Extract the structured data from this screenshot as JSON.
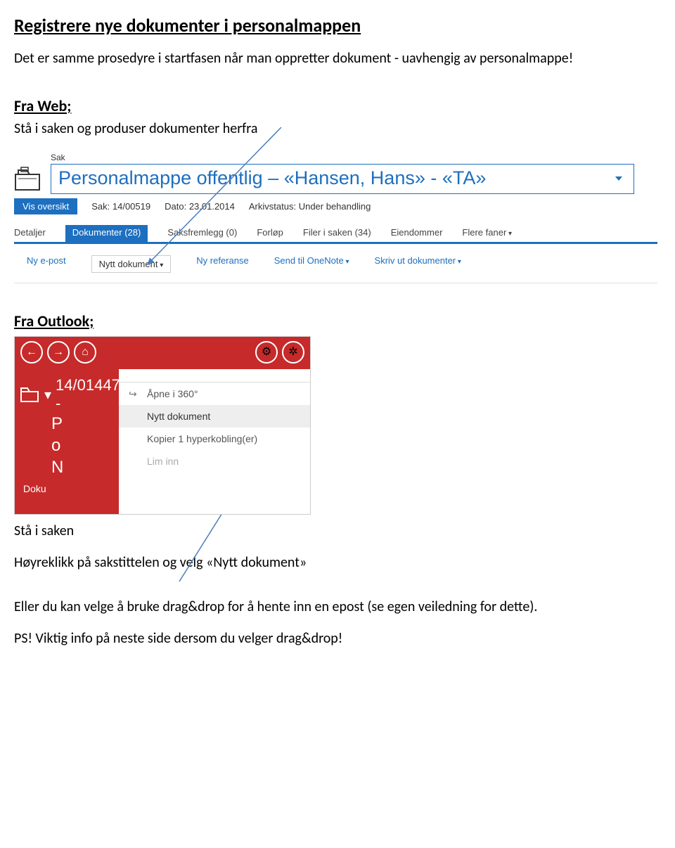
{
  "headings": {
    "h1": "Registrere nye dokumenter i personalmappen",
    "h2a": "Fra Web;",
    "h2b": "Fra Outlook;"
  },
  "paragraphs": {
    "p1": "Det er samme prosedyre i startfasen når man oppretter dokument - uavhengig av personalmappe!",
    "p2": "Stå i saken og produser dokumenter herfra",
    "p3": "Stå i saken",
    "p4": "Høyreklikk på sakstittelen og velg «Nytt dokument»",
    "p5": "Eller du kan velge å bruke drag&drop for å hente inn en epost (se egen veiledning for dette).",
    "p6": "PS! Viktig info på neste side dersom du velger drag&drop!"
  },
  "web": {
    "sak_label": "Sak",
    "title": "Personalmappe offentlig – «Hansen, Hans» - «TA»",
    "vis_oversikt": "Vis oversikt",
    "meta": {
      "sak_key": "Sak:",
      "sak_val": "14/00519",
      "dato_key": "Dato:",
      "dato_val": "23.01.2014",
      "arkiv_key": "Arkivstatus:",
      "arkiv_val": "Under behandling"
    },
    "tabs": {
      "detaljer": "Detaljer",
      "dokumenter": "Dokumenter (28)",
      "saksfremlegg": "Saksfremlegg (0)",
      "forlop": "Forløp",
      "filer": "Filer i saken (34)",
      "eiendommer": "Eiendommer",
      "flere": "Flere faner"
    },
    "actions": {
      "ny_epost": "Ny e-post",
      "nytt_dokument": "Nytt dokument",
      "ny_referanse": "Ny referanse",
      "send_onenote": "Send til OneNote",
      "skriv_ut": "Skriv ut dokumenter"
    }
  },
  "outlook": {
    "case_number": "14/01447 -",
    "lines": {
      "l1": "P",
      "l2": "o",
      "l3": "N"
    },
    "doku": "Doku",
    "menu": {
      "open360": "Åpne i 360°",
      "nytt": "Nytt dokument",
      "kopier": "Kopier 1 hyperkobling(er)",
      "lim_inn": "Lim inn"
    }
  }
}
